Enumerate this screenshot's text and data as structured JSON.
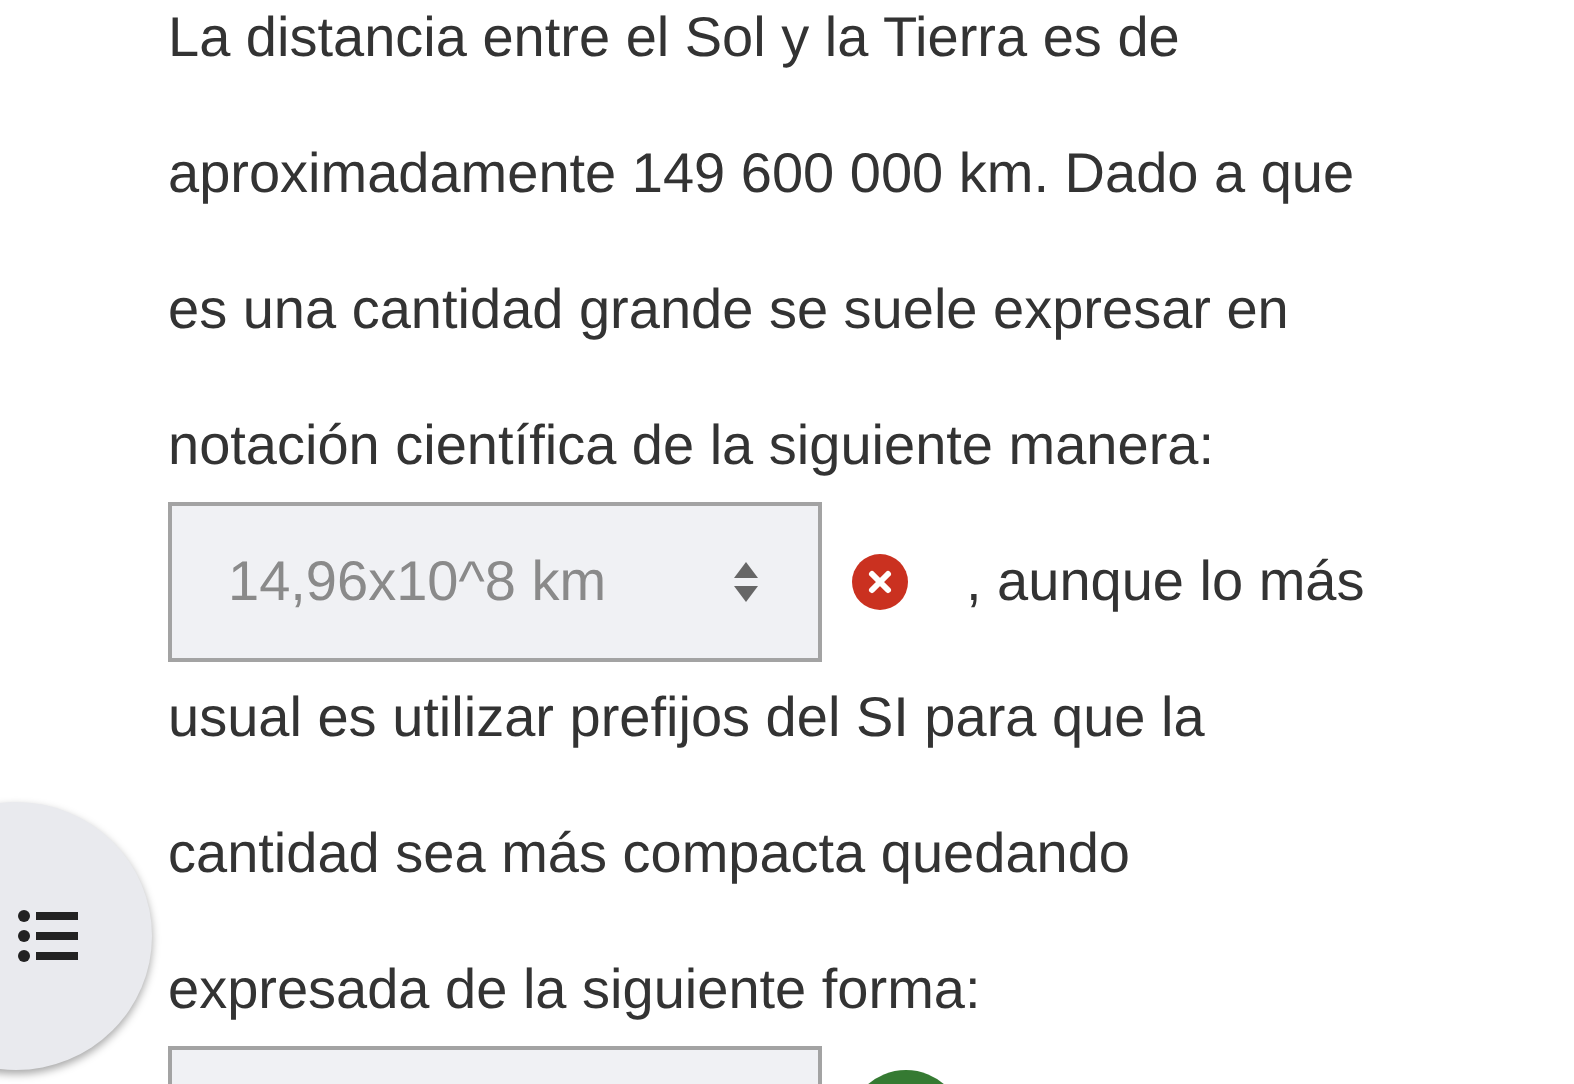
{
  "lines": [
    {
      "kind": "text",
      "text": "La distancia entre el Sol y la Tierra es de"
    },
    {
      "kind": "text",
      "text": "aproximadamente 149 600 000 km. Dado a que"
    },
    {
      "kind": "text",
      "text": "es una cantidad grande se suele expresar en"
    },
    {
      "kind": "text",
      "text": "notación científica de la siguiente manera:"
    },
    {
      "kind": "select",
      "value": "14,96x10^8 km",
      "correct": false,
      "after": ", aunque lo más"
    },
    {
      "kind": "text",
      "text": "usual es utilizar prefijos del SI para que la"
    },
    {
      "kind": "text",
      "text": "cantidad sea más compacta quedando"
    },
    {
      "kind": "text",
      "text": "expresada de la siguiente forma:"
    },
    {
      "kind": "select",
      "correct": true
    }
  ]
}
